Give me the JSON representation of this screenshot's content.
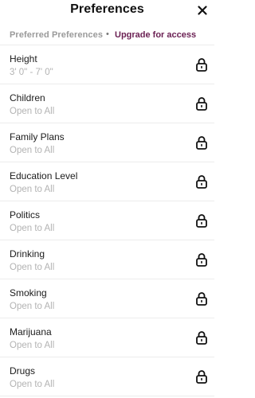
{
  "header": {
    "title": "Preferences",
    "close_glyph": "✕"
  },
  "subheader": {
    "section_label": "Preferred Preferences",
    "separator": "•",
    "upgrade_label": "Upgrade for access"
  },
  "colors": {
    "accent": "#6a1f52",
    "muted_text": "#b3b3b3",
    "divider": "#ececec"
  },
  "preferences": [
    {
      "label": "Height",
      "value": "3' 0\" - 7' 0\"",
      "icon": "lock-icon"
    },
    {
      "label": "Children",
      "value": "Open to All",
      "icon": "lock-icon"
    },
    {
      "label": "Family Plans",
      "value": "Open to All",
      "icon": "lock-icon"
    },
    {
      "label": "Education Level",
      "value": "Open to All",
      "icon": "lock-icon"
    },
    {
      "label": "Politics",
      "value": "Open to All",
      "icon": "lock-icon"
    },
    {
      "label": "Drinking",
      "value": "Open to All",
      "icon": "lock-icon"
    },
    {
      "label": "Smoking",
      "value": "Open to All",
      "icon": "lock-icon"
    },
    {
      "label": "Marijuana",
      "value": "Open to All",
      "icon": "lock-icon"
    },
    {
      "label": "Drugs",
      "value": "Open to All",
      "icon": "lock-icon"
    }
  ]
}
